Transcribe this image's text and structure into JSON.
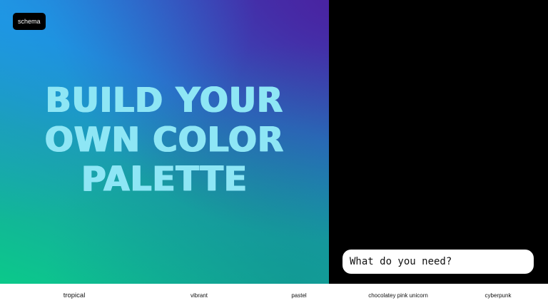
{
  "brand": {
    "logo_text": "schema"
  },
  "hero": {
    "headline_lines": [
      "BUILD YOUR",
      "OWN COLOR",
      "PALETTE"
    ],
    "text_color": "#8ee6f5",
    "gradient_colors": [
      "#4a22a0",
      "#1f86d6",
      "#0bc98a"
    ]
  },
  "prompt": {
    "placeholder": "What do you need?",
    "value": ""
  },
  "suggestions": [
    {
      "label": "tropical"
    },
    {
      "label": "vibrant"
    },
    {
      "label": "pastel"
    },
    {
      "label": "chocolatey pink unicorn"
    },
    {
      "label": "cyberpunk"
    }
  ],
  "colors": {
    "panel_background": "#000000",
    "footer_background": "#ffffff",
    "logo_background": "#000000"
  }
}
